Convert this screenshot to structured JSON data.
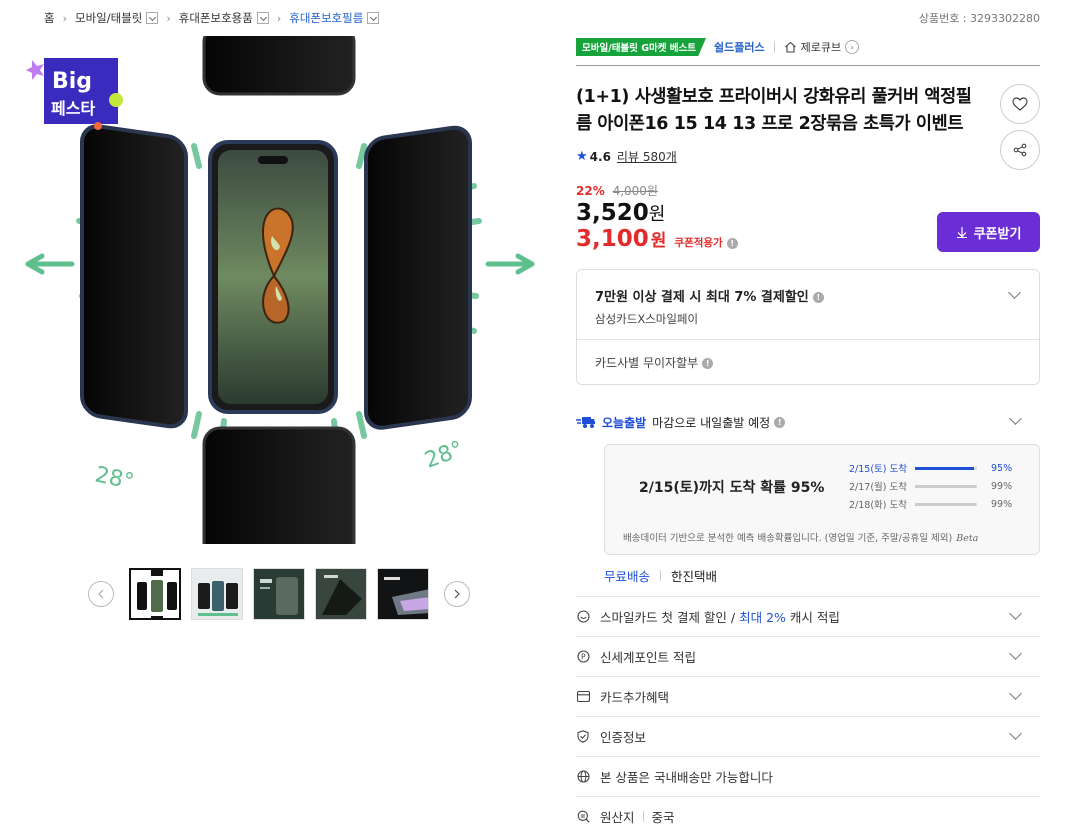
{
  "breadcrumb": {
    "items": [
      {
        "label": "홈"
      },
      {
        "label": "모바일/태블릿"
      },
      {
        "label": "휴대폰보호용품"
      },
      {
        "label": "휴대폰보호필름"
      }
    ]
  },
  "product_no": "상품번호 : 3293302280",
  "gallery": {
    "badge_line1": "Big",
    "badge_line2": "페스타",
    "angle_left": "28°",
    "angle_right": "28°"
  },
  "tags": {
    "best": "모바일/태블릿 G마켓 베스트",
    "shop": "쉴드플러스",
    "zero": "제로큐브"
  },
  "title": "(1+1) 사생활보호 프라이버시 강화유리 풀커버 액정필름 아이폰16 15 14 13 프로 2장묶음 초특가 이벤트",
  "rating": {
    "score": "4.6",
    "review": "리뷰 580개"
  },
  "price": {
    "discount_rate": "22%",
    "original": "4,000원",
    "sale": "3,520",
    "won": "원",
    "coupon_price": "3,100",
    "coupon_label": "쿠폰적용가"
  },
  "coupon_button": "쿠폰받기",
  "payment": {
    "title": "7만원 이상 결제 시 최대 7% 결제할인",
    "sub": "삼성카드X스마일페이",
    "installment": "카드사별 무이자할부"
  },
  "shipping": {
    "today": "오늘출발",
    "desc": "마감으로 내일출발 예정",
    "main": "2/15(토)까지 도착 확률 95%",
    "rows": [
      {
        "date": "2/15(토) 도착",
        "pct": "95%",
        "value": 0.95
      },
      {
        "date": "2/17(월) 도착",
        "pct": "99%",
        "value": 0.99
      },
      {
        "date": "2/18(화) 도착",
        "pct": "99%",
        "value": 0.99
      }
    ],
    "note": "배송데이터 기반으로 분석한 예측 배송확률입니다. (영업일 기준, 주말/공휴일 제외)",
    "beta": "Beta",
    "free": "무료배송",
    "carrier": "한진택배"
  },
  "benefits": {
    "smile_pre": "스마일카드 첫 결제 할인 /",
    "smile_hl": "최대 2%",
    "smile_post": "캐시 적립",
    "shinsegae": "신세계포인트 적립",
    "card_extra": "카드추가혜택",
    "cert": "인증정보",
    "domestic": "본 상품은 국내배송만 가능합니다",
    "origin_label": "원산지",
    "origin_value": "중국"
  }
}
